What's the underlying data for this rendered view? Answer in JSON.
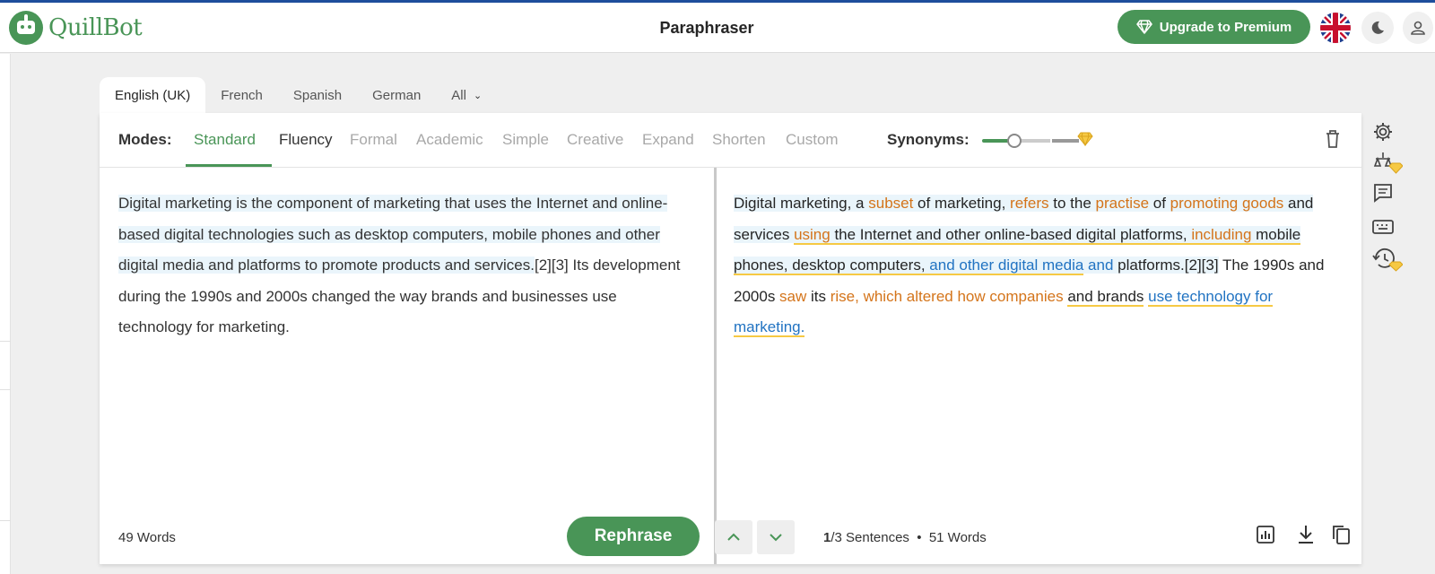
{
  "header": {
    "logo_text": "QuillBot",
    "page_title": "Paraphraser",
    "upgrade_label": "Upgrade to Premium",
    "flag": "uk-flag-icon",
    "dark_mode_icon": "moon-icon",
    "account_icon": "user-icon"
  },
  "colors": {
    "brand": "#499557",
    "added_word": "#d4741a",
    "restructured": "#2173c2",
    "underline": "#f6c944"
  },
  "languages": {
    "tabs": [
      "English (UK)",
      "French",
      "Spanish",
      "German",
      "All"
    ],
    "active": "English (UK)"
  },
  "modes": {
    "label": "Modes:",
    "items": [
      "Standard",
      "Fluency",
      "Formal",
      "Academic",
      "Simple",
      "Creative",
      "Expand",
      "Shorten",
      "Custom"
    ],
    "active": "Standard",
    "synonyms_label": "Synonyms:"
  },
  "input": {
    "text_part1": "Digital marketing is the component of marketing that uses the Internet and online-based digital technologies such as desktop computers, mobile phones and other digital media and platforms to promote products and services.",
    "text_part2": "[2][3] Its development during the 1990s and 2000s changed the way brands and businesses use technology for marketing.",
    "word_count": "49 Words",
    "rephrase_label": "Rephrase"
  },
  "output": {
    "s1": [
      "Digital marketing, a ",
      "subset",
      " of marketing, ",
      "refers",
      " to the ",
      "practise",
      " of ",
      "promoting goods",
      " and services ",
      "using",
      " the Internet and other online-based digital platforms, ",
      "including",
      " mobile phones, desktop computers, ",
      "and other digital media",
      " ",
      "and",
      " platforms.[2][3]"
    ],
    "s2": [
      "The 1990s and 2000s ",
      "saw",
      " its ",
      "rise, which altered how companies",
      " ",
      "and brands",
      " ",
      "use technology for marketing."
    ],
    "sentence_current": "1",
    "sentence_total": "/3 Sentences",
    "word_count": "51 Words"
  }
}
